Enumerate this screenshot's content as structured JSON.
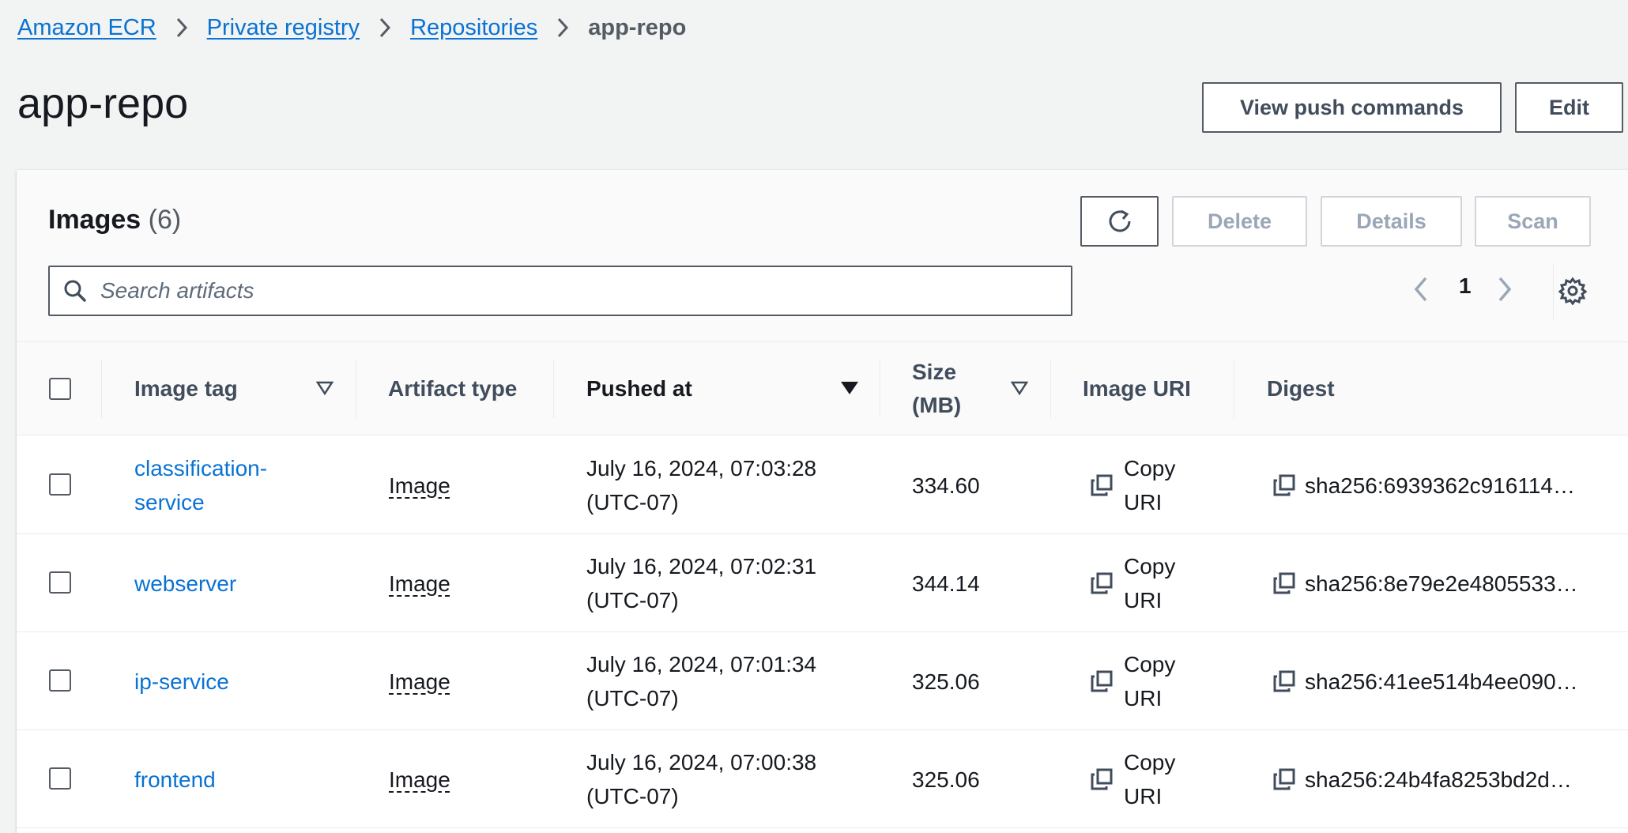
{
  "breadcrumb": {
    "items": [
      "Amazon ECR",
      "Private registry",
      "Repositories"
    ],
    "current": "app-repo"
  },
  "header": {
    "title": "app-repo",
    "view_push_commands_label": "View push commands",
    "edit_label": "Edit"
  },
  "images_panel": {
    "title": "Images",
    "count": "(6)",
    "delete_label": "Delete",
    "details_label": "Details",
    "scan_label": "Scan",
    "search_placeholder": "Search artifacts",
    "page_number": "1"
  },
  "table": {
    "columns": {
      "image_tag": "Image tag",
      "artifact_type": "Artifact type",
      "pushed_at": "Pushed at",
      "size_line1": "Size",
      "size_line2": "(MB)",
      "image_uri": "Image URI",
      "digest": "Digest"
    },
    "rows": [
      {
        "tag_line1": "classification-",
        "tag_line2": "service",
        "artifact": "Image",
        "pushed_line1": "July 16, 2024, 07:03:28",
        "pushed_line2": "(UTC-07)",
        "size": "334.60",
        "uri_line1": "Copy",
        "uri_line2": "URI",
        "digest": "sha256:6939362c916114…"
      },
      {
        "tag_line1": "webserver",
        "tag_line2": "",
        "artifact": "Image",
        "pushed_line1": "July 16, 2024, 07:02:31",
        "pushed_line2": "(UTC-07)",
        "size": "344.14",
        "uri_line1": "Copy",
        "uri_line2": "URI",
        "digest": "sha256:8e79e2e4805533…"
      },
      {
        "tag_line1": "ip-service",
        "tag_line2": "",
        "artifact": "Image",
        "pushed_line1": "July 16, 2024, 07:01:34",
        "pushed_line2": "(UTC-07)",
        "size": "325.06",
        "uri_line1": "Copy",
        "uri_line2": "URI",
        "digest": "sha256:41ee514b4ee090…"
      },
      {
        "tag_line1": "frontend",
        "tag_line2": "",
        "artifact": "Image",
        "pushed_line1": "July 16, 2024, 07:00:38",
        "pushed_line2": "(UTC-07)",
        "size": "325.06",
        "uri_line1": "Copy",
        "uri_line2": "URI",
        "digest": "sha256:24b4fa8253bd2d…"
      }
    ]
  },
  "colors": {
    "link": "#0972d3",
    "background": "#f2f3f3",
    "text": "#16191f"
  }
}
